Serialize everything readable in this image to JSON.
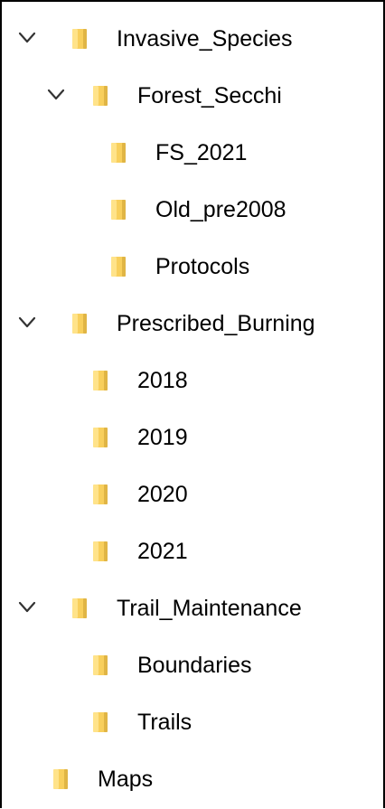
{
  "tree": {
    "invasive_species": "Invasive_Species",
    "forest_secchi": "Forest_Secchi",
    "fs_2021": "FS_2021",
    "old_pre2008": "Old_pre2008",
    "protocols": "Protocols",
    "prescribed_burning": "Prescribed_Burning",
    "y2018": "2018",
    "y2019": "2019",
    "y2020": "2020",
    "y2021": "2021",
    "trail_maintenance": "Trail_Maintenance",
    "boundaries": "Boundaries",
    "trails": "Trails",
    "maps": "Maps"
  },
  "icons": {
    "expand": "chevron-down-icon",
    "folder": "folder-icon"
  },
  "colors": {
    "folder_light": "#ffe38a",
    "folder_mid": "#f8cf5c",
    "folder_dark": "#e0b545",
    "chevron": "#333333"
  }
}
